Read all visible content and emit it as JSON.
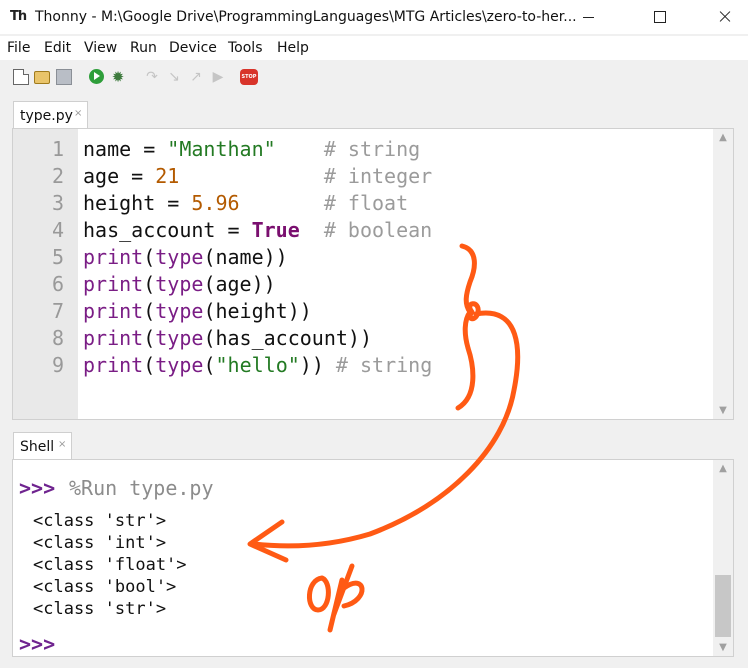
{
  "window": {
    "app_icon": "Th",
    "title": "Thonny  -  M:\\Google Drive\\ProgrammingLanguages\\MTG Articles\\zero-to-her..."
  },
  "menu": [
    "File",
    "Edit",
    "View",
    "Run",
    "Device",
    "Tools",
    "Help"
  ],
  "toolbar": {
    "icons": [
      "new-file-icon",
      "open-folder-icon",
      "save-icon",
      "run-icon",
      "debug-icon",
      "step-over-icon",
      "step-into-icon",
      "step-out-icon",
      "resume-icon",
      "stop-icon"
    ],
    "stop_label": "STOP"
  },
  "editor": {
    "tab_label": "type.py",
    "line_numbers": [
      "1",
      "2",
      "3",
      "4",
      "5",
      "6",
      "7",
      "8",
      "9"
    ]
  },
  "shell": {
    "tab_label": "Shell",
    "prompt": ">>>",
    "run_command": "%Run type.py",
    "output": [
      "<class 'str'>",
      "<class 'int'>",
      "<class 'float'>",
      "<class 'bool'>",
      "<class 'str'>"
    ]
  },
  "tab_close_glyph": "×",
  "annotation": {
    "label": "o/p",
    "color": "#ff5a14"
  },
  "colors": {
    "builtin": "#7a1d85",
    "string": "#237a23",
    "number": "#b35a00",
    "comment": "#9b9b9b",
    "prompt": "#6f248f"
  }
}
